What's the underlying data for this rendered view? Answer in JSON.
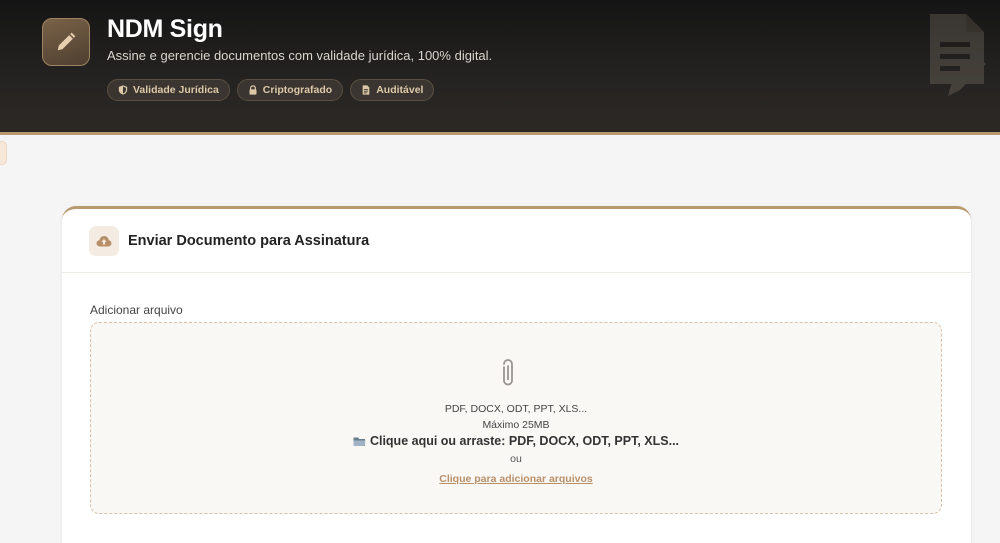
{
  "header": {
    "title": "NDM Sign",
    "subtitle": "Assine e gerencie documentos com validade jurídica, 100% digital.",
    "badges": [
      {
        "label": "Validade Jurídica",
        "icon": "shield-icon"
      },
      {
        "label": "Criptografado",
        "icon": "lock-icon"
      },
      {
        "label": "Auditável",
        "icon": "document-icon"
      }
    ],
    "logo_icon": "pencil-icon",
    "accent_color": "#b99a6e"
  },
  "upload_card": {
    "title": "Enviar Documento para Assinatura",
    "icon": "cloud-upload-icon",
    "field_label": "Adicionar arquivo",
    "dropzone": {
      "icon": "paperclip-icon",
      "formats": "PDF, DOCX, ODT, PPT, XLS...",
      "max_size": "Máximo 25MB",
      "cta": "Clique aqui ou arraste: PDF, DOCX, ODT, PPT, XLS...",
      "cta_icon": "folder-icon",
      "or": "ou",
      "link": "Clique para adicionar arquivos"
    }
  }
}
